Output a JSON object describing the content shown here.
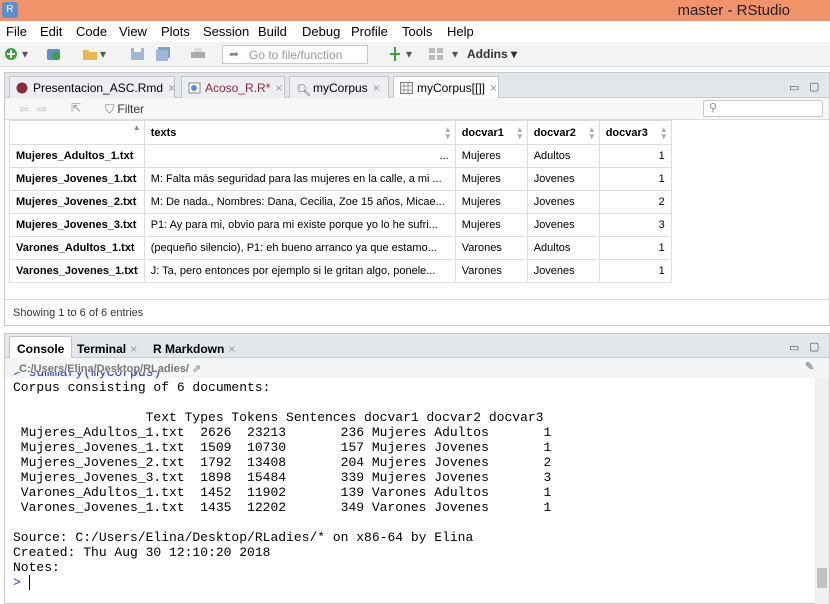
{
  "window": {
    "title": "master - RStudio"
  },
  "menu": [
    "File",
    "Edit",
    "Code",
    "View",
    "Plots",
    "Session",
    "Build",
    "Debug",
    "Profile",
    "Tools",
    "Help"
  ],
  "toolbar": {
    "goto_placeholder": "Go to file/function",
    "addins": "Addins"
  },
  "source_tabs": [
    {
      "label": "Presentacion_ASC.Rmd",
      "icon": "rmd-file-icon"
    },
    {
      "label": "Acoso_R.R*",
      "icon": "r-file-icon"
    },
    {
      "label": "myCorpus",
      "icon": "search-icon"
    },
    {
      "label": "myCorpus[[]]",
      "icon": "table-icon"
    }
  ],
  "filter_label": "Filter",
  "table": {
    "columns": [
      "texts",
      "docvar1",
      "docvar2",
      "docvar3"
    ],
    "rows": [
      {
        "name": "Mujeres_Adultos_1.txt",
        "texts": "...",
        "docvar1": "Mujeres",
        "docvar2": "Adultos",
        "docvar3": "1"
      },
      {
        "name": "Mujeres_Jovenes_1.txt",
        "texts": "M: Falta más seguridad para las mujeres en la calle, a mi ...",
        "docvar1": "Mujeres",
        "docvar2": "Jovenes",
        "docvar3": "1"
      },
      {
        "name": "Mujeres_Jovenes_2.txt",
        "texts": "M: De nada., Nombres: Dana, Cecilia, Zoe 15 años, Micae...",
        "docvar1": "Mujeres",
        "docvar2": "Jovenes",
        "docvar3": "2"
      },
      {
        "name": "Mujeres_Jovenes_3.txt",
        "texts": "P1: Ay para mi, obvio para mi existe porque yo lo he sufri...",
        "docvar1": "Mujeres",
        "docvar2": "Jovenes",
        "docvar3": "3"
      },
      {
        "name": "Varones_Adultos_1.txt",
        "texts": "(pequeño silencio), P1: eh bueno arranco ya que estamo...",
        "docvar1": "Varones",
        "docvar2": "Adultos",
        "docvar3": "1"
      },
      {
        "name": "Varones_Jovenes_1.txt",
        "texts": "J: Ta, pero entonces por ejemplo si le gritan algo, ponele...",
        "docvar1": "Varones",
        "docvar2": "Jovenes",
        "docvar3": "1"
      }
    ],
    "entries_text": "Showing 1 to 6 of 6 entries"
  },
  "console": {
    "tabs": [
      "Console",
      "Terminal",
      "R Markdown"
    ],
    "path": "C:/Users/Elina/Desktop/RLadies/",
    "command": "> summary(myCorpus)",
    "lines": [
      "Corpus consisting of 6 documents:",
      "",
      "                 Text Types Tokens Sentences docvar1 docvar2 docvar3",
      " Mujeres_Adultos_1.txt  2626  23213       236 Mujeres Adultos       1",
      " Mujeres_Jovenes_1.txt  1509  10730       157 Mujeres Jovenes       1",
      " Mujeres_Jovenes_2.txt  1792  13408       204 Mujeres Jovenes       2",
      " Mujeres_Jovenes_3.txt  1898  15484       339 Mujeres Jovenes       3",
      " Varones_Adultos_1.txt  1452  11902       139 Varones Adultos       1",
      " Varones_Jovenes_1.txt  1435  12202       349 Varones Jovenes       1",
      "",
      "Source: C:/Users/Elina/Desktop/RLadies/* on x86-64 by Elina",
      "Created: Thu Aug 30 12:10:20 2018",
      "Notes:"
    ],
    "prompt": ">"
  }
}
